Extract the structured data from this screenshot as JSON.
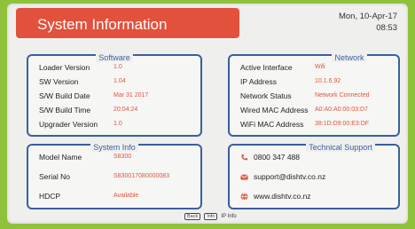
{
  "header": {
    "title": "System Information",
    "date": "Mon, 10-Apr-17",
    "time": "08:53"
  },
  "software": {
    "title": "Software",
    "rows": [
      {
        "label": "Loader Version",
        "value": "1.0"
      },
      {
        "label": "SW Version",
        "value": "1.04"
      },
      {
        "label": "S/W Build Date",
        "value": "Mar 31 2017"
      },
      {
        "label": "S/W Build Time",
        "value": "20:04:24"
      },
      {
        "label": "Upgrader Version",
        "value": "1.0"
      }
    ]
  },
  "network": {
    "title": "Network",
    "rows": [
      {
        "label": "Active Interface",
        "value": "Wifi"
      },
      {
        "label": "IP Address",
        "value": "10.1.6.92"
      },
      {
        "label": "Network Status",
        "value": "Network Connected"
      },
      {
        "label": "Wired MAC Address",
        "value": "A0:A0:A0:00:03:D7"
      },
      {
        "label": "WiFi MAC Address",
        "value": "38:1D:D9:00:E3:DF"
      }
    ]
  },
  "system_info": {
    "title": "System Info",
    "rows": [
      {
        "label": "Model Name",
        "value": "S8300"
      },
      {
        "label": "Serial No",
        "value": "S830017080000083"
      },
      {
        "label": "HDCP",
        "value": "Available"
      }
    ]
  },
  "support": {
    "title": "Technical Support",
    "phone": "0800 347 488",
    "email": "support@dishtv.co.nz",
    "web": "www.dishtv.co.nz"
  },
  "footer": {
    "back_key": "Back",
    "info_key": "Info",
    "info_label": "IP Info"
  }
}
